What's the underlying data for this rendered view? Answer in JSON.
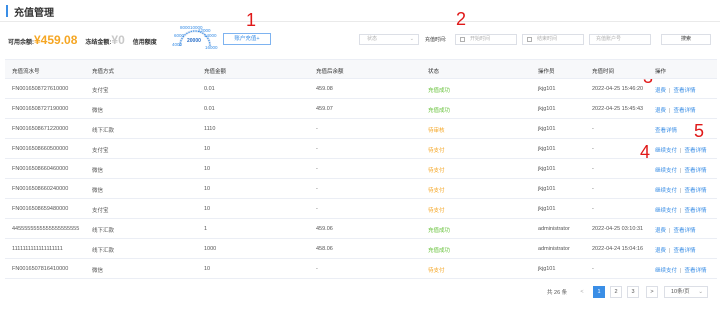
{
  "page": {
    "title": "充值管理"
  },
  "balance": {
    "available_label": "可用余额:",
    "available_value": "¥459.08",
    "frozen_label": "冻结金额:",
    "frozen_value": "¥0",
    "credit_label": "信用额度"
  },
  "gauge": {
    "labels": [
      "4000",
      "6000",
      "8000",
      "10000",
      "12000",
      "14000",
      "16000",
      "18000",
      "20000"
    ],
    "value_label": "20000"
  },
  "recharge_button": "账户充值+",
  "filters": {
    "status_placeholder": "状态",
    "time_label": "充值时间:",
    "start_placeholder": "开始时间",
    "end_placeholder": "结束时间",
    "account_placeholder": "充值账户号",
    "search_label": "搜索"
  },
  "annotations": [
    "1",
    "2",
    "3",
    "4",
    "5"
  ],
  "table": {
    "columns": [
      "充值流水号",
      "充值方式",
      "充值金额",
      "充值后余额",
      "状态",
      "操作员",
      "充值时间",
      "操作"
    ],
    "rows": [
      {
        "id": "FN0016508727610000",
        "method": "支付宝",
        "amount": "0.01",
        "after": "459.08",
        "status": "充值成功",
        "status_type": "ok",
        "operator": "jkjg101",
        "time": "2022-04-25 15:46:20",
        "ops": [
          "退费",
          "查看详情"
        ]
      },
      {
        "id": "FN0016508727190000",
        "method": "微信",
        "amount": "0.01",
        "after": "459.07",
        "status": "充值成功",
        "status_type": "ok",
        "operator": "jkjg101",
        "time": "2022-04-25 15:45:43",
        "ops": [
          "退费",
          "查看详情"
        ]
      },
      {
        "id": "FN0016508671220000",
        "method": "线下汇款",
        "amount": "1110",
        "after": "-",
        "status": "待审核",
        "status_type": "warn",
        "operator": "jkjg101",
        "time": "-",
        "ops": [
          "查看详情"
        ]
      },
      {
        "id": "FN0016508660500000",
        "method": "支付宝",
        "amount": "10",
        "after": "-",
        "status": "待支付",
        "status_type": "warn",
        "operator": "jkjg101",
        "time": "-",
        "ops": [
          "继续支付",
          "查看详情"
        ]
      },
      {
        "id": "FN0016508660460000",
        "method": "微信",
        "amount": "10",
        "after": "-",
        "status": "待支付",
        "status_type": "warn",
        "operator": "jkjg101",
        "time": "-",
        "ops": [
          "继续支付",
          "查看详情"
        ]
      },
      {
        "id": "FN0016508660240000",
        "method": "微信",
        "amount": "10",
        "after": "-",
        "status": "待支付",
        "status_type": "warn",
        "operator": "jkjg101",
        "time": "-",
        "ops": [
          "继续支付",
          "查看详情"
        ]
      },
      {
        "id": "FN0016508659480000",
        "method": "支付宝",
        "amount": "10",
        "after": "-",
        "status": "待支付",
        "status_type": "warn",
        "operator": "jkjg101",
        "time": "-",
        "ops": [
          "继续支付",
          "查看详情"
        ]
      },
      {
        "id": "4455555555555555555555",
        "method": "线下汇款",
        "amount": "1",
        "after": "459.06",
        "status": "充值成功",
        "status_type": "ok",
        "operator": "administrator",
        "time": "2022-04-25 03:10:31",
        "ops": [
          "退费",
          "查看详情"
        ]
      },
      {
        "id": "1111111111111111111",
        "method": "线下汇款",
        "amount": "1000",
        "after": "458.06",
        "status": "充值成功",
        "status_type": "ok",
        "operator": "administrator",
        "time": "2022-04-24 15:04:16",
        "ops": [
          "退费",
          "查看详情"
        ]
      },
      {
        "id": "FN0016507816410000",
        "method": "微信",
        "amount": "10",
        "after": "-",
        "status": "待支付",
        "status_type": "warn",
        "operator": "jkjg101",
        "time": "-",
        "ops": [
          "继续支付",
          "查看详情"
        ]
      }
    ]
  },
  "pagination": {
    "total_label": "共 26 条",
    "prev": "<",
    "pages": [
      "1",
      "2",
      "3"
    ],
    "next": ">",
    "page_size": "10条/页"
  },
  "colors": {
    "accent": "#3a8ee6",
    "balance": "#f5a623",
    "success": "#67c23a",
    "warning": "#f5a623",
    "annotation": "#e01818"
  }
}
